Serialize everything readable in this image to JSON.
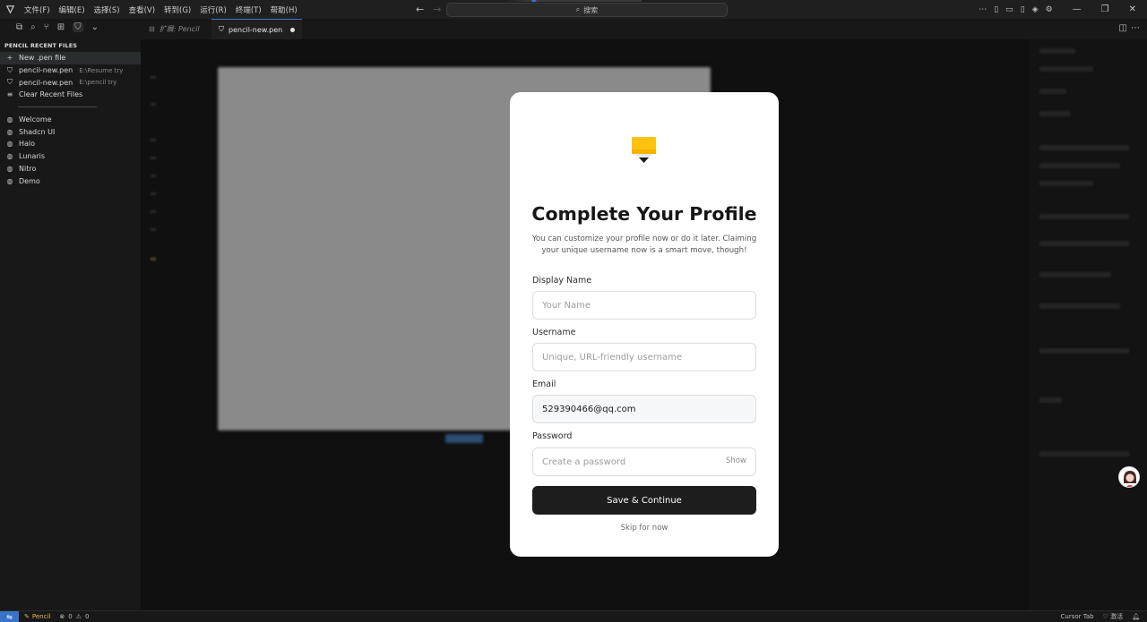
{
  "titlebar": {
    "menus": [
      "文件(F)",
      "编辑(E)",
      "选择(S)",
      "查看(V)",
      "转到(G)",
      "运行(R)",
      "终端(T)",
      "帮助(H)"
    ],
    "search_placeholder": "搜索"
  },
  "tabs": [
    {
      "label": "扩展: Pencil"
    },
    {
      "label": "pencil-new.pen",
      "modified": true
    }
  ],
  "sidebar": {
    "header": "PENCIL RECENT FILES",
    "actions": {
      "new_file": "New .pen file",
      "clear_recent": "Clear Recent Files"
    },
    "recent_files": [
      {
        "name": "pencil-new.pen",
        "path": "E:\\Resume try"
      },
      {
        "name": "pencil-new.pen",
        "path": "E:\\pencil try"
      }
    ],
    "examples": [
      "Welcome",
      "Shadcn UI",
      "Halo",
      "Lunaris",
      "Nitro",
      "Demo"
    ]
  },
  "modal": {
    "title": "Complete Your Profile",
    "subtitle": "You can customize your profile now or do it later. Claiming your unique username now is a smart move, though!",
    "fields": {
      "display_name": {
        "label": "Display Name",
        "placeholder": "Your Name",
        "value": ""
      },
      "username": {
        "label": "Username",
        "placeholder": "Unique, URL-friendly username",
        "value": ""
      },
      "email": {
        "label": "Email",
        "placeholder": "",
        "value": "529390466@qq.com"
      },
      "password": {
        "label": "Password",
        "placeholder": "Create a password",
        "value": "",
        "toggle": "Show"
      }
    },
    "save_label": "Save & Continue",
    "skip_label": "Skip for now"
  },
  "statusbar": {
    "extension": "Pencil",
    "errors": "0",
    "warnings": "0",
    "cursor_tab": "Cursor Tab",
    "activate": "激活"
  },
  "colors": {
    "accent": "#3a74c9",
    "modal_bg": "#ffffff",
    "primary_button": "#1d1d1d",
    "pencil_yellow": "#ffc20e"
  }
}
